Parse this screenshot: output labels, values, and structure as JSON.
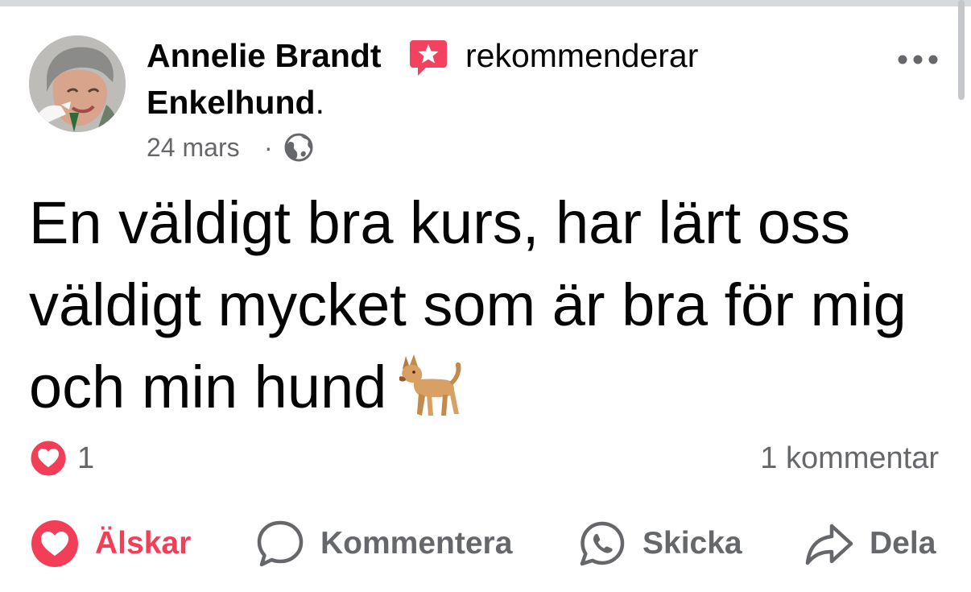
{
  "post": {
    "author": "Annelie Brandt",
    "recommend_verb": "rekommenderar",
    "page_name": "Enkelhund",
    "page_name_suffix": ".",
    "date": "24 mars",
    "separator": "·",
    "audience_icon": "globe-icon",
    "text": "En väldigt bra kurs, har lärt oss väldigt mycket som är bra för mig och min hund",
    "emoji": "dog-emoji"
  },
  "stats": {
    "reaction_icon": "heart-reaction-icon",
    "reaction_count": "1",
    "comment_count": "1 kommentar"
  },
  "actions": {
    "love": "Älskar",
    "comment": "Kommentera",
    "send": "Skicka",
    "share": "Dela"
  },
  "colors": {
    "love_red": "#f33e58",
    "recommend_badge": "#f3425f",
    "secondary_text": "#65676b"
  }
}
